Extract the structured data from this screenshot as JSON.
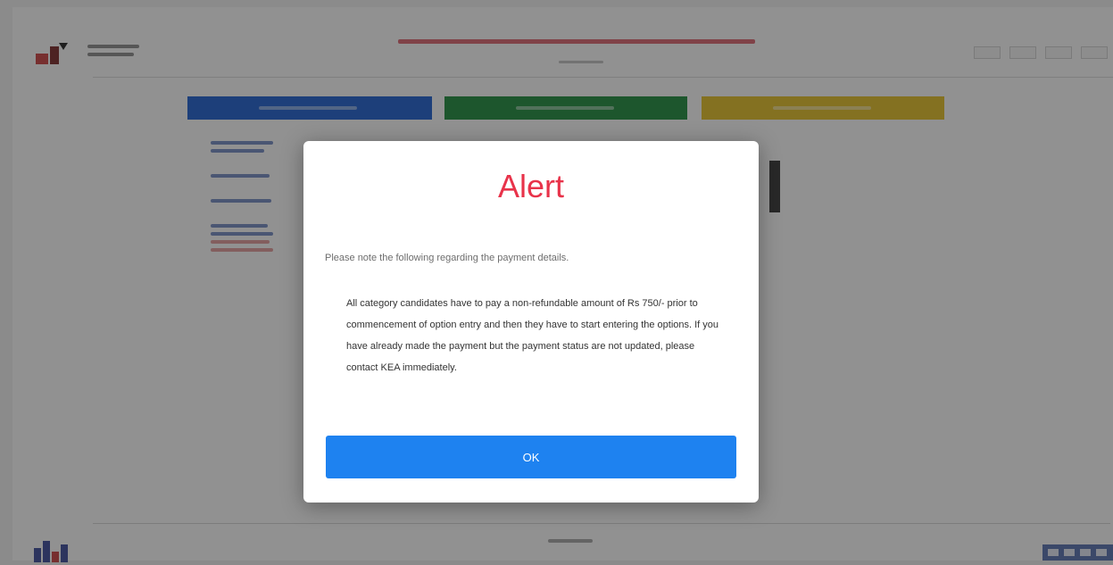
{
  "colors": {
    "alert_title": "#e8334a",
    "ok_button": "#1e82f0",
    "banner_blue": "#1d5fcf",
    "banner_green": "#1e8a3c",
    "banner_yellow": "#e3be25"
  },
  "modal": {
    "title": "Alert",
    "intro": "Please note the following regarding the payment details.",
    "body": "All category candidates have to pay a non-refundable amount of Rs 750/- prior to commencement of option entry and then they have to start entering the options. If you have already made the payment but the payment status are not updated, please contact KEA immediately.",
    "ok_label": "OK"
  },
  "icons": {
    "header_logo": "institution-logo-icon",
    "footer_left": "skyline-logo-icon",
    "footer_right": "kea-logo-icon"
  }
}
